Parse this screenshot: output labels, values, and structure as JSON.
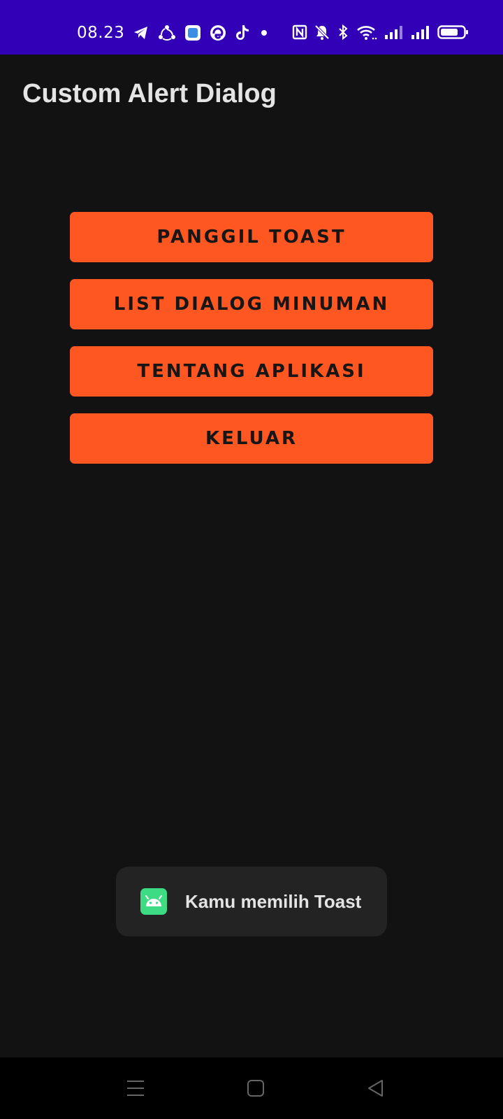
{
  "status_bar": {
    "time": "08.23",
    "background": "#3200b6",
    "left_icons": [
      "telegram-icon",
      "share-icon",
      "app-icon",
      "edge-browser-icon",
      "tiktok-icon",
      "dot-icon"
    ],
    "right_icons": [
      "nfc-icon",
      "mute-icon",
      "bluetooth-icon",
      "wifi-icon",
      "signal-icon",
      "signal-icon",
      "battery-icon"
    ]
  },
  "app_bar": {
    "title": "Custom Alert Dialog"
  },
  "buttons": [
    {
      "label": "PANGGIL TOAST"
    },
    {
      "label": "LIST DIALOG MINUMAN"
    },
    {
      "label": "TENTANG APLIKASI"
    },
    {
      "label": "KELUAR"
    }
  ],
  "toast": {
    "icon": "android-icon",
    "message": "Kamu memilih Toast"
  },
  "nav_bar": {
    "buttons": [
      "menu-icon",
      "home-icon",
      "back-icon"
    ]
  },
  "colors": {
    "background": "#121212",
    "accent": "#ff5722",
    "title_text": "#e4e4e4",
    "toast_background": "#232323",
    "android_green": "#3ddc84"
  }
}
